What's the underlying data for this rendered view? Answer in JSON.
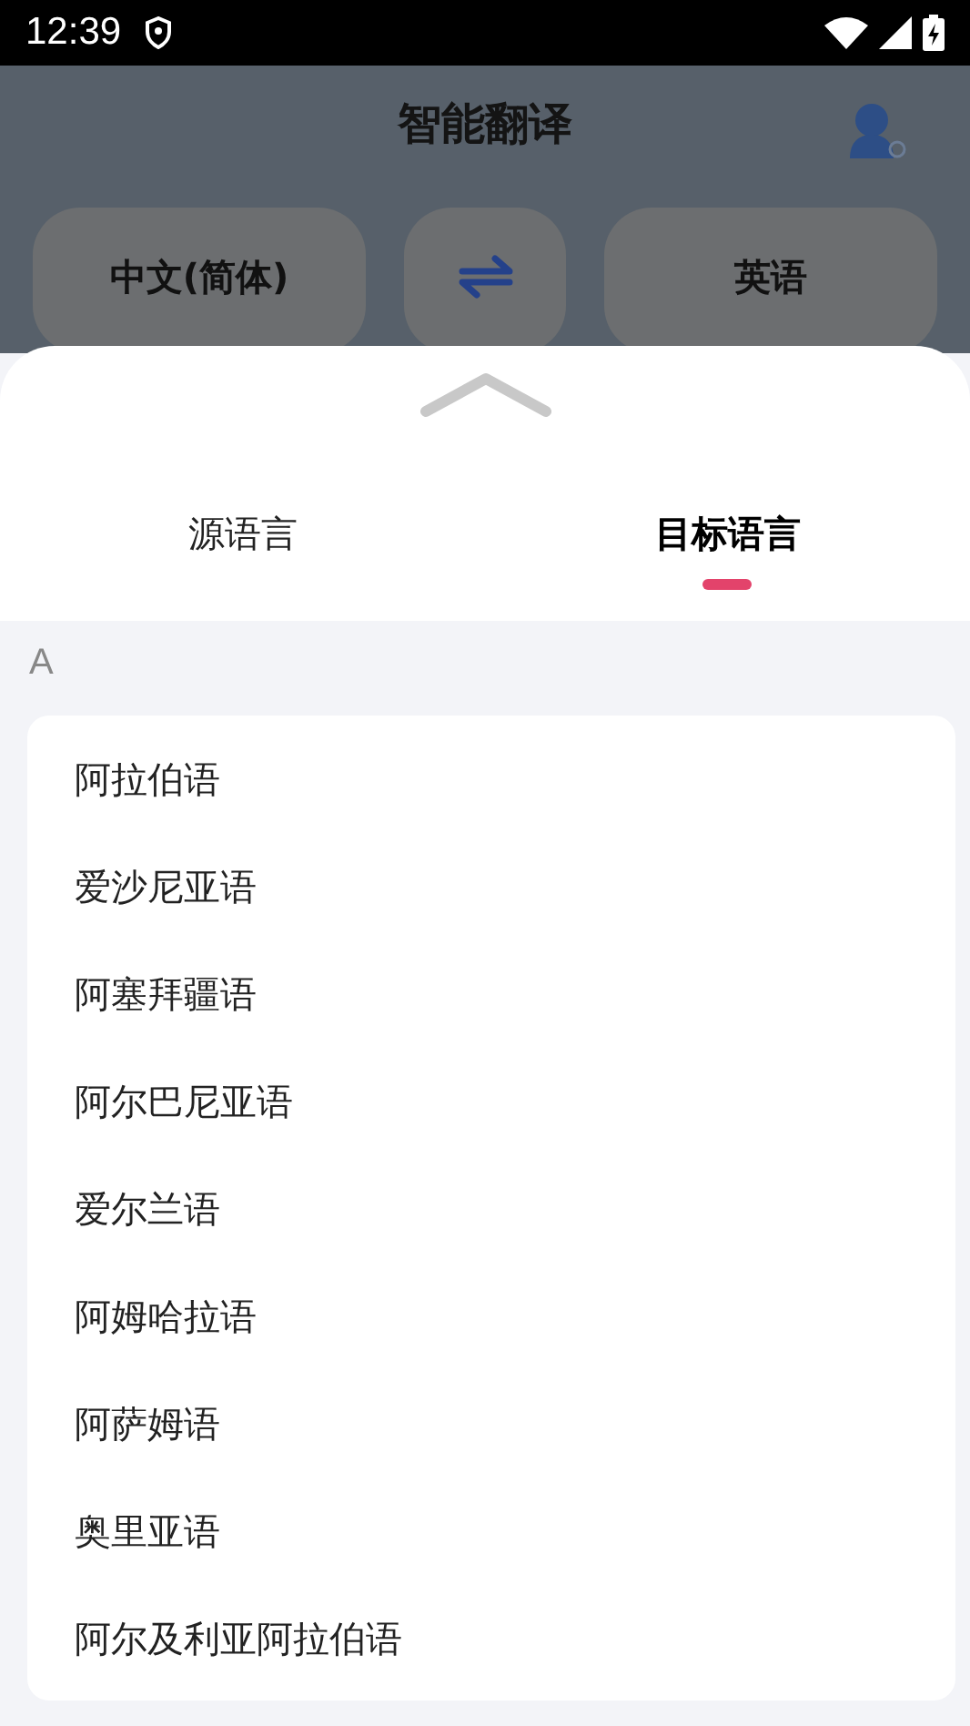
{
  "status_bar": {
    "time": "12:39"
  },
  "header": {
    "title": "智能翻译"
  },
  "language_bar": {
    "source": "中文(简体)",
    "target": "英语"
  },
  "sheet": {
    "tabs": [
      {
        "label": "源语言",
        "selected": false
      },
      {
        "label": "目标语言",
        "selected": true
      }
    ],
    "section": "A",
    "languages": [
      "阿拉伯语",
      "爱沙尼亚语",
      "阿塞拜疆语",
      "阿尔巴尼亚语",
      "爱尔兰语",
      "阿姆哈拉语",
      "阿萨姆语",
      "奥里亚语",
      "阿尔及利亚阿拉伯语"
    ]
  }
}
